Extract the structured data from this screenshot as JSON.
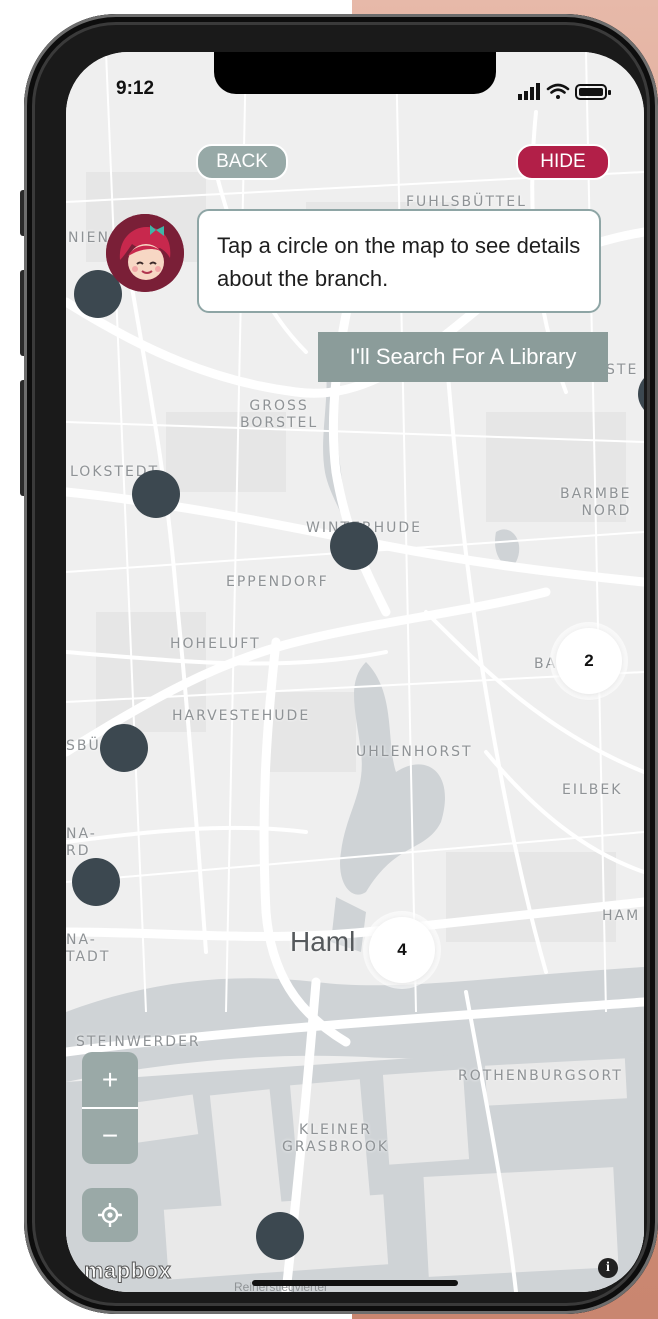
{
  "status_bar": {
    "time": "9:12"
  },
  "toolbar": {
    "back_label": "BACK",
    "hide_label": "HIDE"
  },
  "guide": {
    "message": "Tap a circle on the map to see details about the branch.",
    "search_button_label": "I'll Search For A Library"
  },
  "map": {
    "places": [
      {
        "name": "fuhlsbuttel",
        "label": "FUHLSBÜTTEL"
      },
      {
        "name": "nien",
        "label": "NIEN"
      },
      {
        "name": "gross-borstel",
        "label": "GROSS\nBORSTEL"
      },
      {
        "name": "ste",
        "label": "STE"
      },
      {
        "name": "lokstedt",
        "label": "LOKSTEDT"
      },
      {
        "name": "barmbek-nord",
        "label": "BARMBE\nNORD"
      },
      {
        "name": "winterhude",
        "label": "WINTERHUDE"
      },
      {
        "name": "eppendorf",
        "label": "EPPENDORF"
      },
      {
        "name": "hoheluft",
        "label": "HOHELUFT"
      },
      {
        "name": "barmbek-sud",
        "label": "BA       K-"
      },
      {
        "name": "harvestehude",
        "label": "HARVESTEHUDE"
      },
      {
        "name": "uhlenhorst",
        "label": "UHLENHORST"
      },
      {
        "name": "eimsbuttel",
        "label": "SBÜ"
      },
      {
        "name": "eilbek",
        "label": "EILBEK"
      },
      {
        "name": "altona-nord",
        "label": "NA-\nRD"
      },
      {
        "name": "hamm",
        "label": "HAM"
      },
      {
        "name": "altona-altstadt",
        "label": "NA-\nTADT"
      },
      {
        "name": "steinwerder",
        "label": "STEINWERDER"
      },
      {
        "name": "rothenburgsort",
        "label": "ROTHENBURGSORT"
      },
      {
        "name": "kleiner-grasbrook",
        "label": "KLEINER\nGRASBROOK"
      }
    ],
    "city_label": "Haml",
    "street_bottom": "Reiherstiegviertel",
    "clusters": [
      {
        "count": "2"
      },
      {
        "count": "4"
      }
    ],
    "zoom_in": "+",
    "zoom_out": "−",
    "attribution": "mapbox",
    "info": "i"
  },
  "colors": {
    "accent_hide": "#b21f48",
    "button_grey": "#97a9a7",
    "marker": "#3c4850"
  }
}
